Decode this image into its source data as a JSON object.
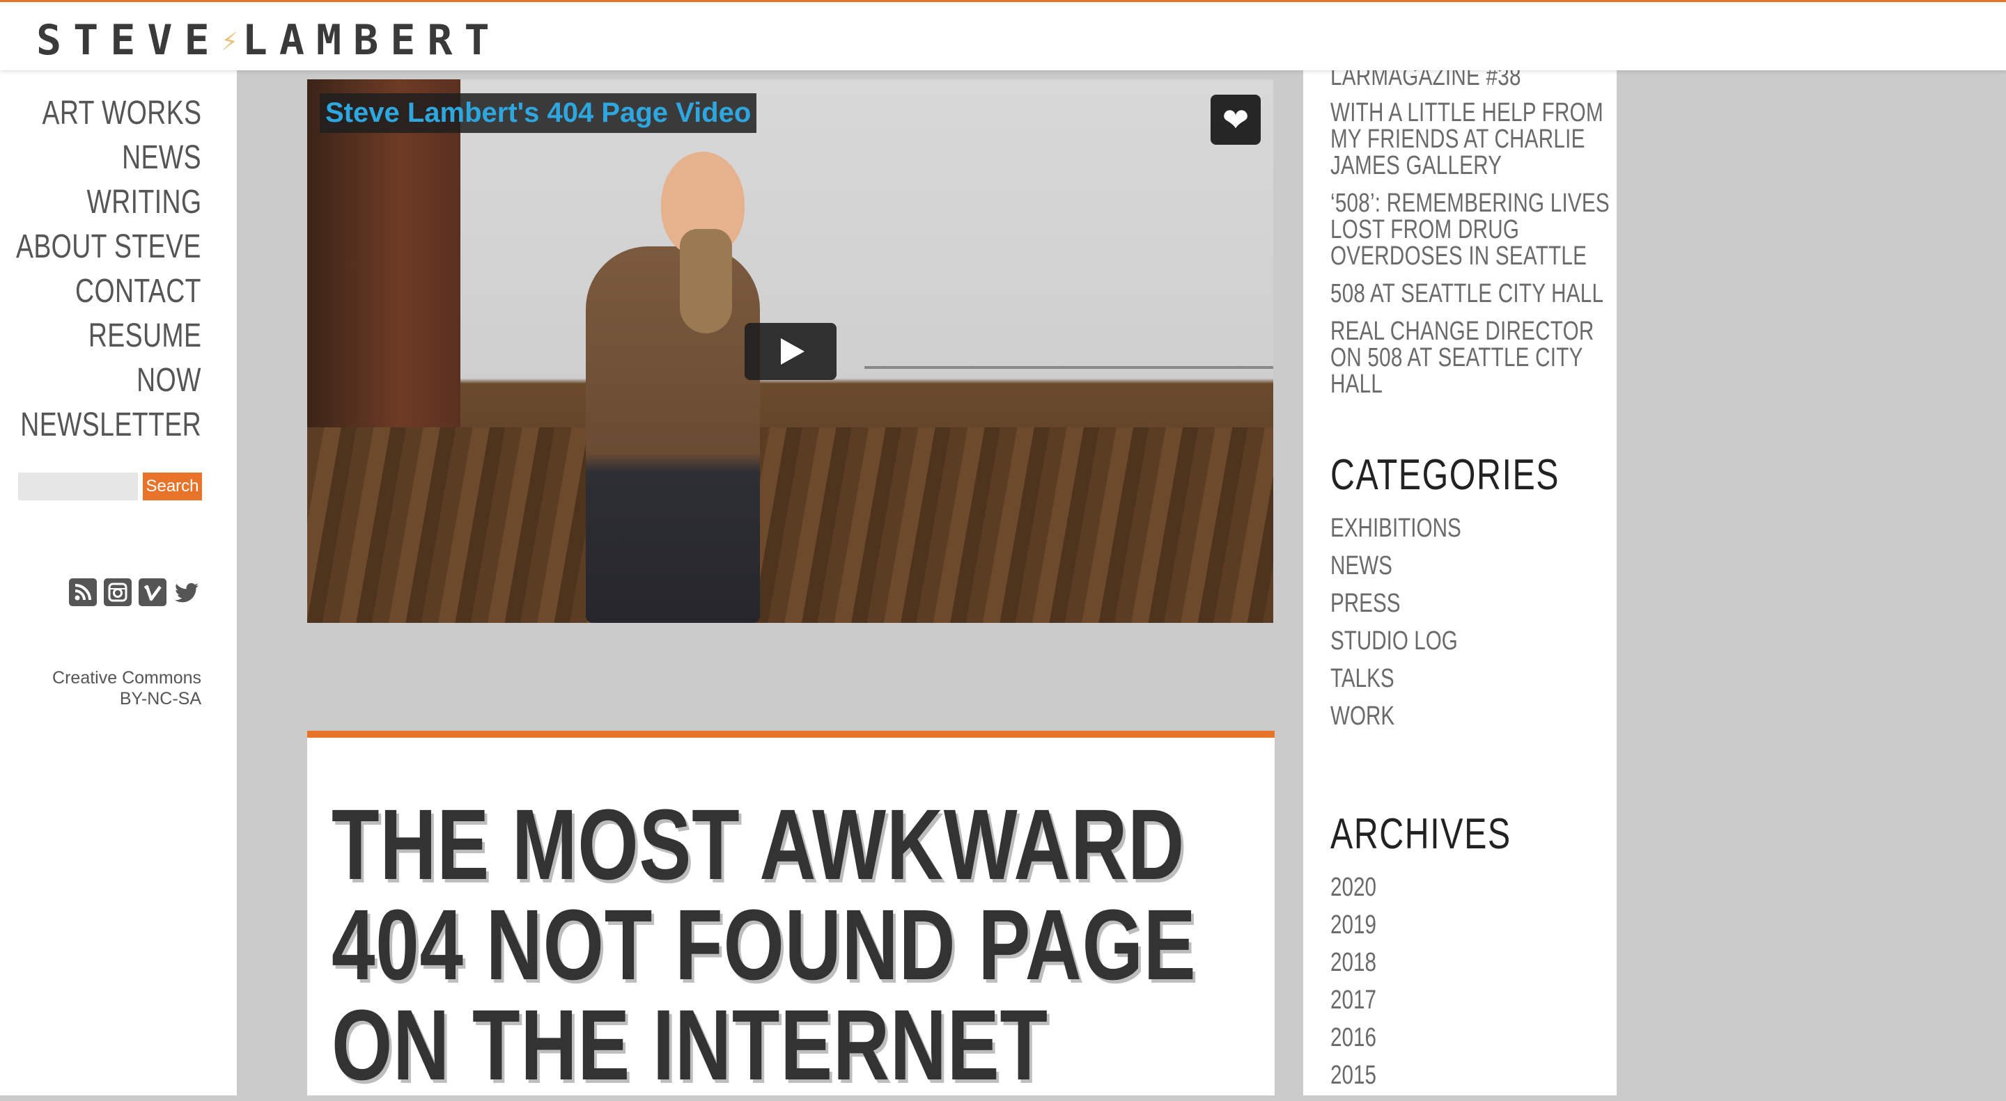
{
  "header": {
    "logo_left": "STEVE",
    "logo_bolt": "⚡",
    "logo_right": "LAMBERT"
  },
  "nav": [
    "ART WORKS",
    "NEWS",
    "WRITING",
    "ABOUT STEVE",
    "CONTACT",
    "RESUME",
    "NOW",
    "NEWSLETTER"
  ],
  "search": {
    "placeholder": "",
    "button_label": "Search"
  },
  "social": [
    "rss-icon",
    "instagram-icon",
    "vimeo-icon",
    "twitter-icon"
  ],
  "license": {
    "line1": "Creative Commons",
    "line2": "BY-NC-SA"
  },
  "video": {
    "title": "Steve Lambert's 404 Page Video"
  },
  "article": {
    "title": "THE MOST AWKWARD 404 NOT FOUND PAGE ON THE INTERNET"
  },
  "sidebar": {
    "recent": [
      "LARMAGAZINE #38",
      "WITH A LITTLE HELP FROM MY FRIENDS AT CHARLIE JAMES GALLERY",
      "‘508’: REMEMBERING LIVES LOST FROM DRUG OVERDOSES IN SEATTLE",
      "508 AT SEATTLE CITY HALL",
      "REAL CHANGE DIRECTOR ON 508 AT SEATTLE CITY HALL"
    ],
    "categories_heading": "CATEGORIES",
    "categories": [
      "EXHIBITIONS",
      "NEWS",
      "PRESS",
      "STUDIO LOG",
      "TALKS",
      "WORK"
    ],
    "archives_heading": "ARCHIVES",
    "archives": [
      "2020",
      "2019",
      "2018",
      "2017",
      "2016",
      "2015"
    ]
  }
}
